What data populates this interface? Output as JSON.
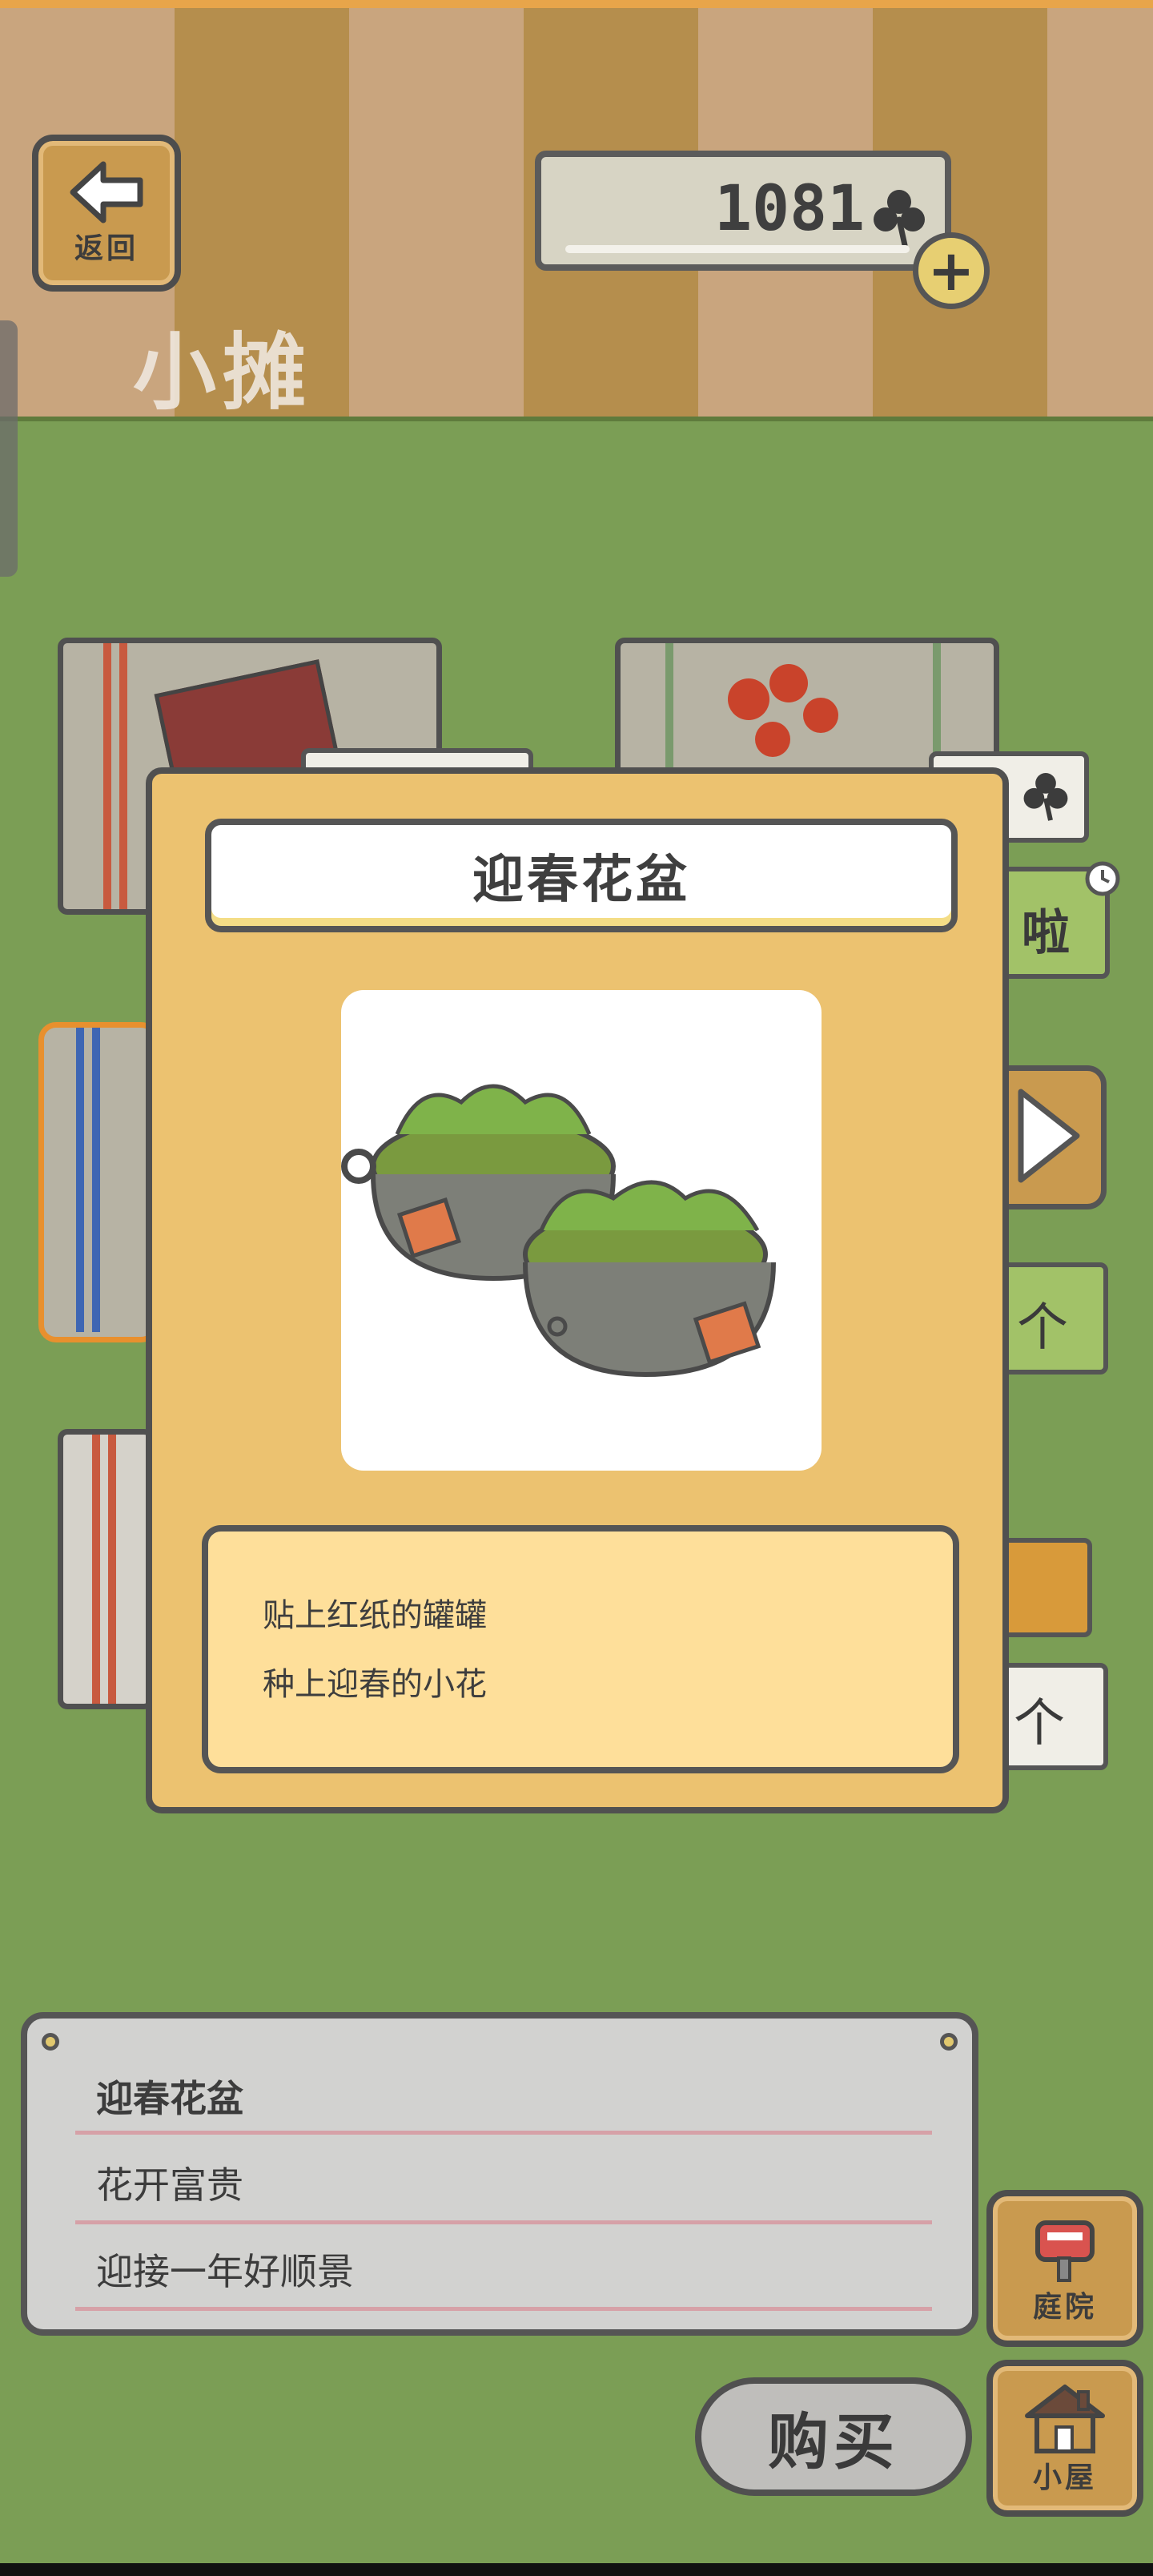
{
  "header": {
    "back_label": "返回",
    "shop_title": "小摊",
    "clover_count": "1081",
    "add_label": "+"
  },
  "background_tags": {
    "tag_1": "啦",
    "tag_2": "个",
    "tag_3": "个"
  },
  "modal": {
    "title": "迎春花盆",
    "description": [
      "贴上红纸的罐罐",
      "种上迎春的小花"
    ]
  },
  "info_board": {
    "item_name": "迎春花盆",
    "line_1": "花开富贵",
    "line_2": "迎接一年好顺景"
  },
  "nav": {
    "yard_label": "庭院",
    "house_label": "小屋",
    "buy_label": "购买"
  },
  "icons": [
    "arrow-left-icon",
    "clover-icon",
    "plus-icon",
    "clock-icon",
    "sparkle-icon",
    "play-arrow-icon",
    "mailbox-icon",
    "house-icon"
  ]
}
